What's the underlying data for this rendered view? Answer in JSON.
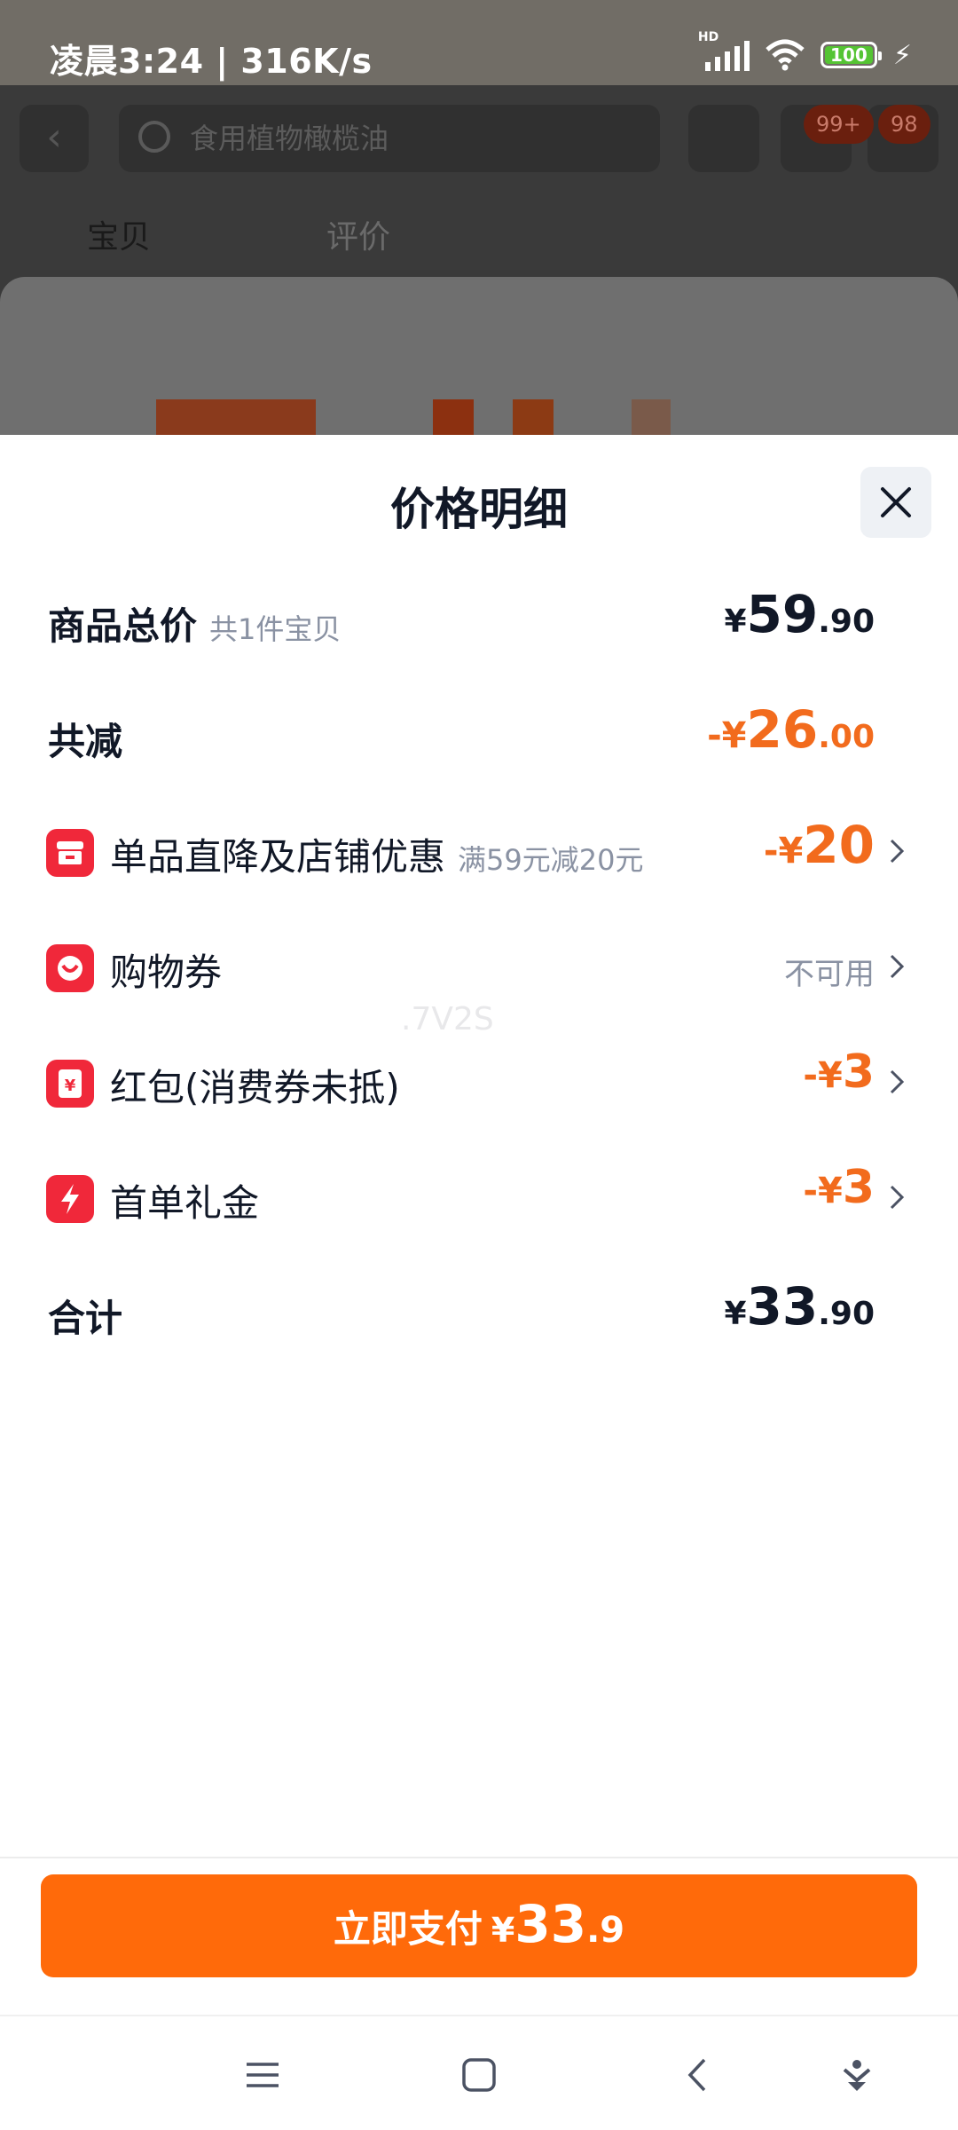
{
  "status_bar": {
    "time": "凌晨3:24 | 316K/s",
    "network": "HD",
    "battery": "100"
  },
  "background_page": {
    "search_placeholder": "食用植物橄榄油",
    "cart_badge": "99+",
    "message_badge": "98",
    "tabs": [
      "宝贝",
      "评价"
    ]
  },
  "sheet": {
    "title": "价格明细",
    "rows": {
      "subtotal": {
        "label": "商品总价",
        "sub": "共1件宝贝",
        "yen": "¥",
        "int": "59",
        "dec": ".90"
      },
      "total_reduction": {
        "label": "共减",
        "prefix": "-¥",
        "int": "26",
        "dec": ".00"
      },
      "store_discount": {
        "label": "单品直降及店铺优惠",
        "sub": "满59元减20元",
        "prefix": "-¥",
        "int": "20",
        "icon": "store-icon"
      },
      "coupon": {
        "label": "购物券",
        "status": "不可用",
        "icon": "coupon-icon"
      },
      "red_packet": {
        "label": "红包(消费券未抵)",
        "prefix": "-¥",
        "int": "3",
        "icon": "red-packet-icon"
      },
      "first_order": {
        "label": "首单礼金",
        "prefix": "-¥",
        "int": "3",
        "icon": "bolt-icon"
      },
      "total": {
        "label": "合计",
        "yen": "¥",
        "int": "33",
        "dec": ".90"
      }
    },
    "watermark": ".7V2S"
  },
  "pay_button": {
    "label": "立即支付",
    "yen": "¥",
    "int": "33",
    "dec": ".9"
  },
  "colors": {
    "accent": "#ff6a0a",
    "discount": "#f26b1d",
    "icon_red": "#f0283a"
  }
}
